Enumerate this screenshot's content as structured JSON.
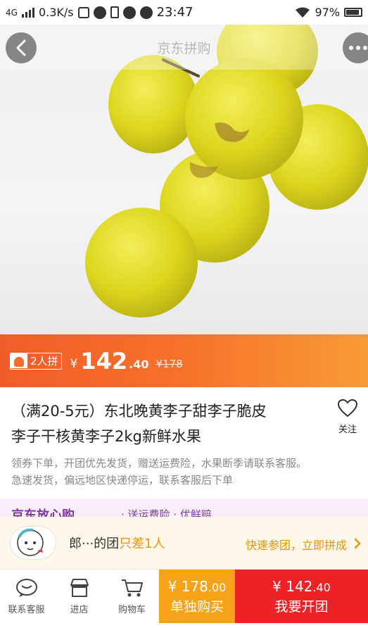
{
  "status_bar": {
    "network": "4G",
    "speed": "0.3K/s",
    "time": "23:47",
    "battery": "97%"
  },
  "nav": {
    "title": "京东拼购"
  },
  "carousel": {
    "count": 5,
    "active_index": 3
  },
  "price_banner": {
    "group_tag": "2人拼",
    "currency": "¥",
    "price_int": "142",
    "price_dec": ".40",
    "original_price": "¥178"
  },
  "product": {
    "title_line1": "（满20-5元）东北晚黄李子甜李子脆皮",
    "title_line2": "李子干核黄李子2kg新鲜水果",
    "favorite_label": "关注",
    "desc_line1": "领券下单，开团优先发货，赠送运费险，水果断季请联系客服。",
    "desc_line2": "急速发货，偏远地区快递停运，联系客服后下单"
  },
  "promo": {
    "brand": "京东放心购",
    "tags": "· 送运费险 · 优鲜赔"
  },
  "group": {
    "name": "郎···的团",
    "need": "只差1人",
    "join_label": "快速参团，立即拼成"
  },
  "bottom_bar": {
    "service_label": "联系客服",
    "shop_label": "进店",
    "cart_label": "购物车",
    "buy_alone_price": "¥ 178",
    "buy_alone_price_dec": ".00",
    "buy_alone_label": "单独购买",
    "buy_group_price": "¥ 142",
    "buy_group_price_dec": ".40",
    "buy_group_label": "我要开团"
  },
  "colors": {
    "accent_orange": "#f6722a",
    "buy_alone": "#f7a318",
    "buy_group": "#ec2226",
    "group_highlight": "#f0950a"
  }
}
